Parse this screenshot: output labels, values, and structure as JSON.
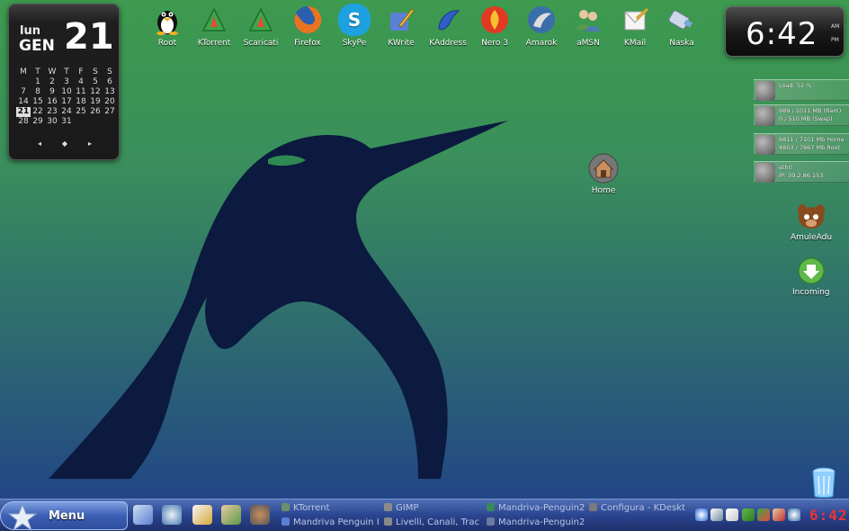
{
  "calendar": {
    "day_short": "lun",
    "month_short": "GEN",
    "day_number": "21",
    "weekday_headers": [
      "M",
      "T",
      "W",
      "T",
      "F",
      "S",
      "S"
    ],
    "weeks": [
      [
        "",
        "",
        "",
        "",
        "",
        "",
        ""
      ],
      [
        "",
        "",
        "1",
        "2",
        "3",
        "4",
        "5",
        "6"
      ],
      [
        "7",
        "8",
        "9",
        "10",
        "11",
        "12",
        "13"
      ],
      [
        "14",
        "15",
        "16",
        "17",
        "18",
        "19",
        "20"
      ],
      [
        "21",
        "22",
        "23",
        "24",
        "25",
        "26",
        "27"
      ],
      [
        "28",
        "29",
        "30",
        "31",
        "",
        "",
        ""
      ]
    ],
    "selected_day": "21",
    "nav_prev": "◂",
    "nav_today": "◆",
    "nav_next": "▸"
  },
  "top_icons": [
    {
      "label": "Root",
      "icon": "tux-icon",
      "color": "#333333"
    },
    {
      "label": "KTorrent",
      "icon": "ktorrent-icon",
      "color": "#3aa84a"
    },
    {
      "label": "Scaricati",
      "icon": "downloads-icon",
      "color": "#3aa84a"
    },
    {
      "label": "Firefox",
      "icon": "firefox-icon",
      "color": "#e66a1f"
    },
    {
      "label": "SkyPe",
      "icon": "skype-icon",
      "color": "#1da1e0"
    },
    {
      "label": "KWrite",
      "icon": "kwrite-icon",
      "color": "#5a7fd4"
    },
    {
      "label": "KAddress",
      "icon": "kaddress-icon",
      "color": "#2f5fc4"
    },
    {
      "label": "Nero 3",
      "icon": "nero-icon",
      "color": "#e23a22"
    },
    {
      "label": "Amarok",
      "icon": "amarok-icon",
      "color": "#3a6ea8"
    },
    {
      "label": "aMSN",
      "icon": "amsn-icon",
      "color": "#6b9e56"
    },
    {
      "label": "KMail",
      "icon": "kmail-icon",
      "color": "#d8a73a"
    },
    {
      "label": "Naska",
      "icon": "usb-drive-icon",
      "color": "#7aa8d8"
    }
  ],
  "clock": {
    "time": "6:42",
    "am": "AM",
    "pm": "PM"
  },
  "monitors": [
    {
      "line1": "Load:    52 %",
      "line2": "",
      "icon": "cpu-icon"
    },
    {
      "line1": "989 / 1011 MB (Ram)",
      "line2": "0 / 510 MB (Swap)",
      "icon": "memory-icon"
    },
    {
      "line1": "6811 / 7101 Mb Home",
      "line2": "4803 / 7867 Mb Root",
      "icon": "harddisk-icon"
    },
    {
      "line1": "eth0",
      "line2": "IP: 39.2.86.153",
      "icon": "network-icon"
    }
  ],
  "desktop_icons": {
    "home": "Home",
    "amule": "AmuleAdu",
    "incoming": "Incoming"
  },
  "taskbar": {
    "menu_label": "Menu",
    "tasks": [
      {
        "label": "KTorrent",
        "color": "#6a8f6a"
      },
      {
        "label": "Mandriva Penguin K",
        "color": "#5a7fd4"
      },
      {
        "label": "GIMP",
        "color": "#8a8a8a"
      },
      {
        "label": "Livelli, Canali, Trac",
        "color": "#8a8a8a"
      },
      {
        "label": "Mandriva-Penguin2",
        "color": "#3a8a5a"
      },
      {
        "label": "Mandriva-Penguin2",
        "color": "#6a7aa0"
      },
      {
        "label": "Configura - KDeskt",
        "color": "#7a7a7a"
      }
    ],
    "tray_clock": "6:42",
    "colors": {
      "panel": "#2b4590",
      "task_text": "#b8c6e6",
      "tray_clock": "#ee3333"
    }
  }
}
